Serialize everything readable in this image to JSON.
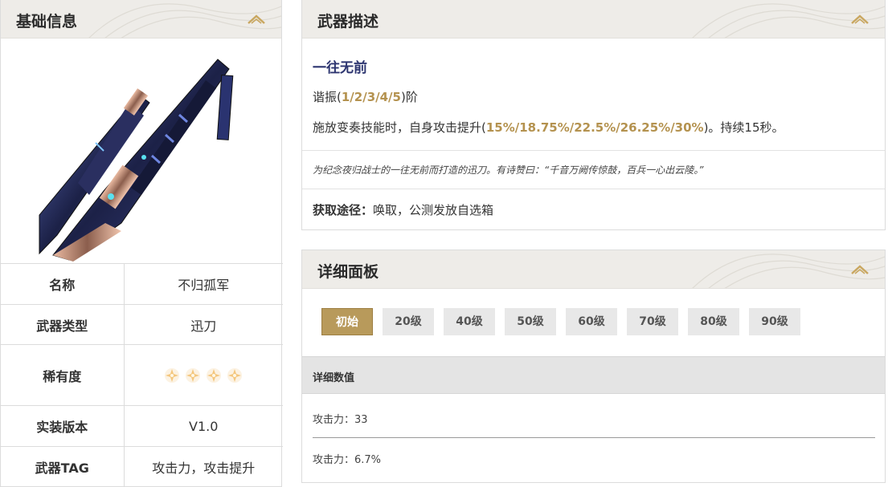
{
  "basic_info": {
    "title": "基础信息",
    "rows": [
      {
        "key": "名称",
        "value": "不归孤军"
      },
      {
        "key": "武器类型",
        "value": "迅刀"
      },
      {
        "key": "稀有度",
        "stars": 4
      },
      {
        "key": "实装版本",
        "value": "V1.0"
      },
      {
        "key": "武器TAG",
        "value": "攻击力，攻击提升"
      }
    ]
  },
  "weapon_desc": {
    "title": "武器描述",
    "skill_name": "一往无前",
    "rank_prefix": "谐振(",
    "rank_values": "1/2/3/4/5",
    "rank_suffix": ")阶",
    "effect_prefix": "施放变奏技能时，自身攻击提升(",
    "effect_values": "15%/18.75%/22.5%/26.25%/30%",
    "effect_suffix": ")。持续15秒。",
    "flavor": "为纪念夜归战士的一往无前而打造的迅刀。有诗赞曰：“千音万阙传惊鼓，百兵一心出云陵。”",
    "obtain_label": "获取途径：",
    "obtain_value": "唤取，公测发放自选箱"
  },
  "detail_panel": {
    "title": "详细面板",
    "levels": [
      "初始",
      "20级",
      "40级",
      "50级",
      "60级",
      "70级",
      "80级",
      "90级"
    ],
    "active_level": "初始",
    "stats_header": "详细数值",
    "stats": [
      "攻击力：33",
      "攻击力：6.7%"
    ]
  },
  "colors": {
    "accent_gold": "#b4924f",
    "skill_name": "#2d3570",
    "header_bg": "#eeece8"
  }
}
